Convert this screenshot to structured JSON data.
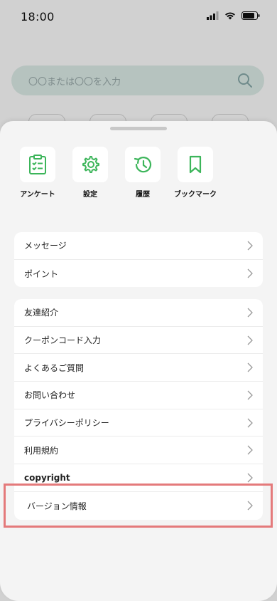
{
  "status": {
    "time": "18:00"
  },
  "search": {
    "placeholder": "〇〇または〇〇を入力"
  },
  "quick_actions": [
    {
      "label": "アンケート",
      "icon": "clipboard-check-icon"
    },
    {
      "label": "設定",
      "icon": "gear-icon"
    },
    {
      "label": "履歴",
      "icon": "history-icon"
    },
    {
      "label": "ブックマーク",
      "icon": "bookmark-icon"
    }
  ],
  "menu_group_1": [
    {
      "label": "メッセージ"
    },
    {
      "label": "ポイント"
    }
  ],
  "menu_group_2": [
    {
      "label": "友達紹介"
    },
    {
      "label": "クーポンコード入力"
    },
    {
      "label": "よくあるご質問"
    },
    {
      "label": "お問い合わせ"
    },
    {
      "label": "プライバシーポリシー"
    },
    {
      "label": "利用規約"
    },
    {
      "label": "copyright"
    },
    {
      "label": "バージョン情報"
    }
  ],
  "colors": {
    "accent": "#3cb55a",
    "highlight": "#e47a7b"
  }
}
